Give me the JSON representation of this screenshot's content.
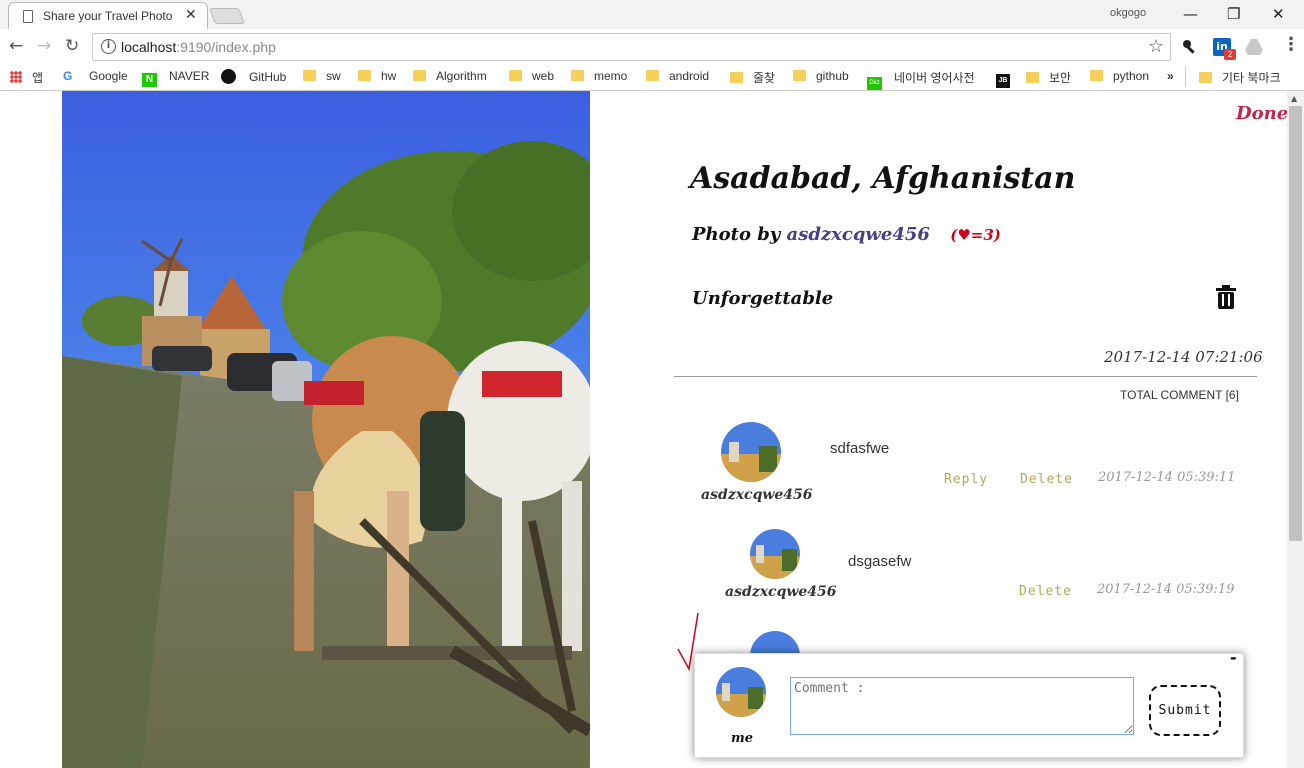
{
  "browser": {
    "tab_title": "Share your Travel Photo",
    "profile_name": "okgogo",
    "url_host": "localhost",
    "url_rest": ":9190/index.php",
    "extension_badge": "2",
    "bookmarks": [
      {
        "label": "앱",
        "icon": "apps-grid-icon"
      },
      {
        "label": "Google",
        "icon": "google-icon"
      },
      {
        "label": "NAVER",
        "icon": "naver-icon"
      },
      {
        "label": "GitHub",
        "icon": "github-icon"
      },
      {
        "label": "sw",
        "icon": "folder-icon"
      },
      {
        "label": "hw",
        "icon": "folder-icon"
      },
      {
        "label": "Algorithm",
        "icon": "folder-icon"
      },
      {
        "label": "web",
        "icon": "folder-icon"
      },
      {
        "label": "memo",
        "icon": "folder-icon"
      },
      {
        "label": "android",
        "icon": "folder-icon"
      },
      {
        "label": "줄찾",
        "icon": "folder-icon"
      },
      {
        "label": "github",
        "icon": "folder-icon"
      },
      {
        "label": "네이버 영어사전",
        "icon": "naver-dict-icon"
      },
      {
        "label": "보안",
        "icon": "folder-icon"
      },
      {
        "label": "python",
        "icon": "folder-icon"
      },
      {
        "label": "»",
        "icon": "overflow-icon"
      },
      {
        "label": "기타 북마크",
        "icon": "folder-icon"
      }
    ]
  },
  "post": {
    "done_label": "Done",
    "place": "Asadabad, Afghanistan",
    "photo_by_label": "Photo by",
    "author": "asdzxcqwe456",
    "likes": "(♥=3)",
    "caption": "Unforgettable",
    "date": "2017-12-14 07:21:06",
    "total_comment": "TOTAL COMMENT [6]"
  },
  "comments": [
    {
      "user": "asdzxcqwe456",
      "text": "sdfasfwe",
      "reply": "Reply",
      "delete": "Delete",
      "date": "2017-12-14 05:39:11"
    },
    {
      "user": "asdzxcqwe456",
      "text": "dsgasefw",
      "delete": "Delete",
      "date": "2017-12-14 05:39:19"
    }
  ],
  "comment_form": {
    "minimize": "-",
    "user": "me",
    "placeholder": "Comment :",
    "submit": "Submit"
  },
  "colors": {
    "accent_done": "#c8234a",
    "author": "#4a3d87",
    "likes": "#d0021b",
    "action": "#b3a85a"
  }
}
